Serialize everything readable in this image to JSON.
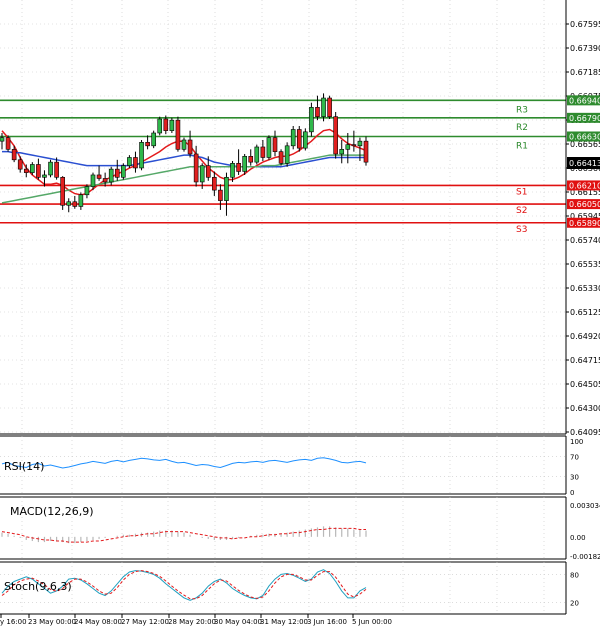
{
  "chart_data": {
    "type": "line",
    "price_axis_ticks": [
      "0.67595",
      "0.67390",
      "0.67185",
      "0.66975",
      "0.66770",
      "0.66565",
      "0.66360",
      "0.66155",
      "0.65945",
      "0.65740",
      "0.65535",
      "0.65330",
      "0.65125",
      "0.64920",
      "0.64715",
      "0.64505",
      "0.64300",
      "0.64095"
    ],
    "price_axis_range": [
      0.64095,
      0.67595
    ],
    "current_price": "0.66413",
    "levels": [
      {
        "name": "R3",
        "value": 0.6694,
        "label": "0.66940",
        "color": "#2e8b2e"
      },
      {
        "name": "R2",
        "value": 0.6679,
        "label": "0.66790",
        "color": "#2e8b2e"
      },
      {
        "name": "R1",
        "value": 0.6663,
        "label": "0.66630",
        "color": "#2e8b2e"
      },
      {
        "name": "S1",
        "value": 0.6621,
        "label": "0.66210",
        "color": "#e01010"
      },
      {
        "name": "S2",
        "value": 0.6605,
        "label": "0.66050",
        "color": "#e01010"
      },
      {
        "name": "S3",
        "value": 0.6589,
        "label": "0.65890",
        "color": "#e01010"
      }
    ],
    "x_ticks": [
      "y 16:00",
      "23 May 00:00",
      "24 May 08:00",
      "27 May 12:00",
      "28 May 20:00",
      "30 May 04:00",
      "31 May 12:00",
      "3 Jun 16:00",
      "5 Jun 00:00"
    ],
    "candles": [
      [
        0.6659,
        0.6666,
        0.6652,
        0.6662
      ],
      [
        0.6662,
        0.6664,
        0.665,
        0.6652
      ],
      [
        0.6652,
        0.6655,
        0.6641,
        0.6643
      ],
      [
        0.6643,
        0.6646,
        0.6632,
        0.6635
      ],
      [
        0.6635,
        0.6639,
        0.6628,
        0.6632
      ],
      [
        0.6632,
        0.6641,
        0.663,
        0.6639
      ],
      [
        0.6639,
        0.6644,
        0.6626,
        0.6628
      ],
      [
        0.6628,
        0.6634,
        0.662,
        0.663
      ],
      [
        0.663,
        0.6643,
        0.6628,
        0.6641
      ],
      [
        0.6641,
        0.6645,
        0.6626,
        0.6628
      ],
      [
        0.6628,
        0.6629,
        0.66,
        0.6604
      ],
      [
        0.6604,
        0.661,
        0.6598,
        0.6607
      ],
      [
        0.6607,
        0.6612,
        0.6601,
        0.6603
      ],
      [
        0.6603,
        0.6615,
        0.66,
        0.6613
      ],
      [
        0.6613,
        0.6622,
        0.661,
        0.662
      ],
      [
        0.662,
        0.6632,
        0.6617,
        0.663
      ],
      [
        0.663,
        0.6638,
        0.6625,
        0.6627
      ],
      [
        0.6627,
        0.6632,
        0.662,
        0.6624
      ],
      [
        0.6624,
        0.6637,
        0.6621,
        0.6635
      ],
      [
        0.6635,
        0.6643,
        0.6625,
        0.6628
      ],
      [
        0.6628,
        0.664,
        0.6626,
        0.6638
      ],
      [
        0.6638,
        0.6647,
        0.6636,
        0.6645
      ],
      [
        0.6645,
        0.665,
        0.6632,
        0.6636
      ],
      [
        0.6636,
        0.666,
        0.6634,
        0.6658
      ],
      [
        0.6658,
        0.6664,
        0.6652,
        0.6655
      ],
      [
        0.6655,
        0.6668,
        0.6653,
        0.6666
      ],
      [
        0.6666,
        0.668,
        0.6664,
        0.6678
      ],
      [
        0.6678,
        0.6681,
        0.6665,
        0.6668
      ],
      [
        0.6668,
        0.6679,
        0.6666,
        0.6677
      ],
      [
        0.6677,
        0.668,
        0.665,
        0.6652
      ],
      [
        0.6652,
        0.6662,
        0.665,
        0.666
      ],
      [
        0.666,
        0.6668,
        0.6645,
        0.6648
      ],
      [
        0.6648,
        0.6655,
        0.662,
        0.6624
      ],
      [
        0.6624,
        0.664,
        0.6618,
        0.6638
      ],
      [
        0.6638,
        0.6646,
        0.6625,
        0.6628
      ],
      [
        0.6628,
        0.6633,
        0.6612,
        0.6617
      ],
      [
        0.6617,
        0.6622,
        0.66,
        0.6608
      ],
      [
        0.6608,
        0.6632,
        0.6595,
        0.6628
      ],
      [
        0.6628,
        0.6642,
        0.6624,
        0.664
      ],
      [
        0.664,
        0.6652,
        0.663,
        0.6633
      ],
      [
        0.6633,
        0.6648,
        0.663,
        0.6646
      ],
      [
        0.6646,
        0.6652,
        0.6638,
        0.6641
      ],
      [
        0.6641,
        0.6656,
        0.6639,
        0.6654
      ],
      [
        0.6654,
        0.666,
        0.6642,
        0.6645
      ],
      [
        0.6645,
        0.6664,
        0.6643,
        0.6662
      ],
      [
        0.6662,
        0.6668,
        0.6646,
        0.665
      ],
      [
        0.665,
        0.6652,
        0.6638,
        0.664
      ],
      [
        0.664,
        0.6658,
        0.6637,
        0.6655
      ],
      [
        0.6655,
        0.6672,
        0.6652,
        0.6669
      ],
      [
        0.6669,
        0.6672,
        0.665,
        0.6653
      ],
      [
        0.6653,
        0.667,
        0.6651,
        0.6667
      ],
      [
        0.6667,
        0.6692,
        0.6663,
        0.6688
      ],
      [
        0.6688,
        0.6698,
        0.6677,
        0.668
      ],
      [
        0.668,
        0.67,
        0.6676,
        0.6696
      ],
      [
        0.6696,
        0.6698,
        0.6678,
        0.668
      ],
      [
        0.668,
        0.6684,
        0.6644,
        0.6648
      ],
      [
        0.6648,
        0.666,
        0.664,
        0.6652
      ],
      [
        0.6652,
        0.6666,
        0.664,
        0.6656
      ],
      [
        0.6656,
        0.6668,
        0.665,
        0.6655
      ],
      [
        0.6655,
        0.6662,
        0.6642,
        0.6659
      ],
      [
        0.6659,
        0.6663,
        0.6638,
        0.6641
      ]
    ],
    "moving_averages": [
      {
        "color": "#e31a1c",
        "values": [
          0.6668,
          0.6662,
          0.6655,
          0.6645,
          0.6636,
          0.663,
          0.6626,
          0.6622,
          0.6622,
          0.6623,
          0.6621,
          0.6617,
          0.6614,
          0.6613,
          0.6614,
          0.6618,
          0.6622,
          0.6626,
          0.6628,
          0.6631,
          0.6633,
          0.6636,
          0.6638,
          0.6641,
          0.6644,
          0.6647,
          0.665,
          0.6654,
          0.6657,
          0.6659,
          0.6659,
          0.6655,
          0.6648,
          0.6642,
          0.6636,
          0.6632,
          0.6628,
          0.6626,
          0.6626,
          0.6628,
          0.6631,
          0.6635,
          0.6638,
          0.6641,
          0.6643,
          0.6645,
          0.6646,
          0.6646,
          0.6648,
          0.6651,
          0.6655,
          0.6659,
          0.6664,
          0.6668,
          0.6669,
          0.6666,
          0.6661,
          0.6657,
          0.6655,
          0.6653,
          0.6651
        ]
      },
      {
        "color": "#2a4fd1",
        "values": [
          0.665,
          0.665,
          0.6649,
          0.6649,
          0.6648,
          0.6647,
          0.6646,
          0.6645,
          0.6644,
          0.6643,
          0.6642,
          0.6641,
          0.664,
          0.6639,
          0.6638,
          0.6638,
          0.6638,
          0.6638,
          0.6638,
          0.6638,
          0.6638,
          0.6638,
          0.6639,
          0.664,
          0.6641,
          0.6642,
          0.6643,
          0.6644,
          0.6645,
          0.6646,
          0.6647,
          0.6647,
          0.6646,
          0.6645,
          0.6643,
          0.6641,
          0.664,
          0.6639,
          0.6638,
          0.6637,
          0.6637,
          0.6637,
          0.6637,
          0.6637,
          0.6637,
          0.6637,
          0.6637,
          0.6638,
          0.6639,
          0.664,
          0.6641,
          0.6642,
          0.6643,
          0.6644,
          0.6645,
          0.6645,
          0.6645,
          0.6645,
          0.6645,
          0.6645,
          0.6645
        ]
      },
      {
        "color": "#55a868",
        "values": [
          0.6606,
          0.6607,
          0.6608,
          0.6609,
          0.661,
          0.6611,
          0.6612,
          0.6613,
          0.6614,
          0.6615,
          0.6616,
          0.6617,
          0.6618,
          0.6619,
          0.662,
          0.6621,
          0.6622,
          0.6623,
          0.6624,
          0.6625,
          0.6626,
          0.6627,
          0.6628,
          0.6629,
          0.663,
          0.6631,
          0.6632,
          0.6633,
          0.6634,
          0.6635,
          0.6636,
          0.6637,
          0.6637,
          0.6637,
          0.6637,
          0.6637,
          0.6637,
          0.6637,
          0.6637,
          0.6637,
          0.6637,
          0.6637,
          0.6637,
          0.6638,
          0.6638,
          0.6638,
          0.6639,
          0.664,
          0.6641,
          0.6642,
          0.6643,
          0.6644,
          0.6645,
          0.6646,
          0.6647,
          0.6647,
          0.6647,
          0.6647,
          0.6647,
          0.6647,
          0.6647
        ]
      }
    ],
    "rsi": {
      "label": "RSI(14)",
      "ticks": [
        "100",
        "70",
        "30",
        "0"
      ],
      "range": [
        0,
        100
      ],
      "values": [
        55,
        58,
        52,
        50,
        48,
        54,
        56,
        51,
        53,
        50,
        47,
        49,
        52,
        55,
        57,
        60,
        58,
        56,
        60,
        62,
        59,
        62,
        64,
        66,
        65,
        63,
        62,
        64,
        60,
        57,
        58,
        55,
        52,
        54,
        53,
        50,
        48,
        52,
        56,
        58,
        57,
        59,
        60,
        58,
        61,
        62,
        60,
        58,
        61,
        63,
        64,
        62,
        66,
        67,
        65,
        62,
        58,
        57,
        59,
        60,
        57
      ]
    },
    "macd": {
      "label": "MACD(12,26,9)",
      "ticks": [
        "0.003034",
        "0.00",
        "-0.001826"
      ],
      "range": [
        -0.001826,
        0.003034
      ],
      "histogram": [
        0.0004,
        0.0003,
        0.0001,
        -0.0001,
        -0.0003,
        -0.0004,
        -0.0005,
        -0.0005,
        -0.0004,
        -0.0004,
        -0.0005,
        -0.0006,
        -0.0006,
        -0.0005,
        -0.0004,
        -0.0003,
        -0.0002,
        -0.0001,
        0.0,
        0.0001,
        0.0002,
        0.0002,
        0.0003,
        0.0004,
        0.0004,
        0.0005,
        0.0006,
        0.0006,
        0.0006,
        0.0005,
        0.0004,
        0.0002,
        0.0,
        -0.0001,
        -0.0002,
        -0.0003,
        -0.0003,
        -0.0003,
        -0.0002,
        -0.0001,
        0.0,
        0.0001,
        0.0002,
        0.0002,
        0.0003,
        0.0003,
        0.0003,
        0.0004,
        0.0005,
        0.0006,
        0.0007,
        0.0008,
        0.0009,
        0.001,
        0.001,
        0.0009,
        0.0008,
        0.0008,
        0.0007,
        0.0007,
        0.0006
      ],
      "signal": [
        0.0005,
        0.0004,
        0.0003,
        0.0002,
        0.0,
        -0.0001,
        -0.0002,
        -0.0003,
        -0.0003,
        -0.0004,
        -0.0004,
        -0.0005,
        -0.0005,
        -0.0005,
        -0.0005,
        -0.0004,
        -0.0004,
        -0.0003,
        -0.0002,
        -0.0001,
        0.0,
        0.0001,
        0.0001,
        0.0002,
        0.0003,
        0.0003,
        0.0004,
        0.0005,
        0.0005,
        0.0005,
        0.0005,
        0.0004,
        0.0003,
        0.0002,
        0.0001,
        0.0,
        -0.0001,
        -0.0001,
        -0.0002,
        -0.0001,
        -0.0001,
        0.0,
        0.0,
        0.0001,
        0.0002,
        0.0002,
        0.0003,
        0.0003,
        0.0004,
        0.0004,
        0.0005,
        0.0006,
        0.0007,
        0.0007,
        0.0008,
        0.0008,
        0.0008,
        0.0008,
        0.0008,
        0.0007,
        0.0007
      ]
    },
    "stoch": {
      "label": "Stoch(9,6,3)",
      "ticks": [
        "80",
        "20"
      ],
      "range": [
        0,
        100
      ],
      "k": [
        40,
        55,
        65,
        70,
        75,
        70,
        60,
        50,
        40,
        45,
        55,
        70,
        72,
        68,
        60,
        50,
        40,
        35,
        45,
        60,
        75,
        85,
        88,
        87,
        84,
        80,
        72,
        60,
        50,
        40,
        30,
        25,
        30,
        40,
        55,
        65,
        70,
        62,
        50,
        42,
        35,
        30,
        28,
        35,
        55,
        70,
        80,
        82,
        78,
        72,
        65,
        70,
        85,
        90,
        82,
        65,
        45,
        30,
        30,
        45,
        52
      ],
      "d": [
        35,
        45,
        58,
        66,
        70,
        72,
        66,
        58,
        48,
        44,
        50,
        62,
        70,
        70,
        64,
        55,
        45,
        38,
        40,
        52,
        68,
        80,
        86,
        88,
        86,
        82,
        76,
        66,
        55,
        45,
        36,
        28,
        28,
        35,
        48,
        60,
        68,
        66,
        56,
        46,
        38,
        32,
        29,
        32,
        45,
        62,
        75,
        80,
        80,
        75,
        68,
        68,
        78,
        86,
        86,
        74,
        56,
        38,
        32,
        38,
        48
      ]
    }
  }
}
